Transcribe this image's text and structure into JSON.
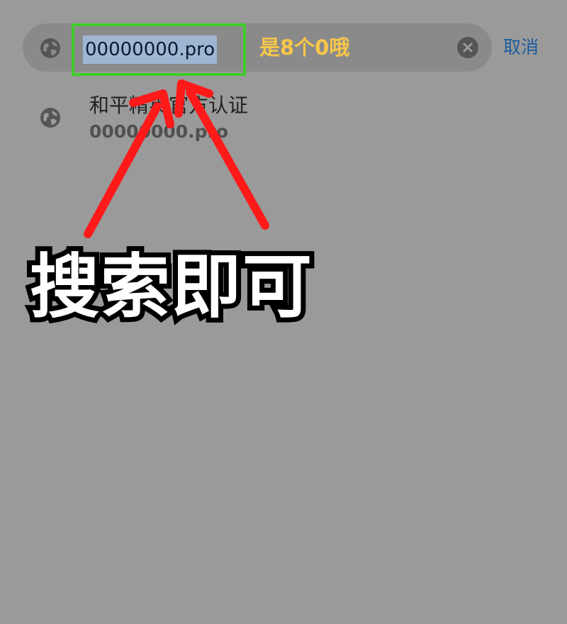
{
  "search": {
    "url_value": "00000000.pro",
    "hint": "是8个0哦",
    "cancel_label": "取消"
  },
  "suggestion": {
    "title": "和平精英官方认证",
    "url": "00000000.pro"
  },
  "callout": "搜索即可",
  "icons": {
    "search_globe": "globe-icon",
    "suggestion_globe": "globe-icon",
    "clear": "clear-icon",
    "arrows": "red-arrow-annotation"
  },
  "colors": {
    "background": "#9a9a9a",
    "highlight_border": "#3fcc2a",
    "hint_text": "#f7c64a",
    "cancel_text": "#1a5c9e",
    "arrow": "#ff1a1a"
  }
}
